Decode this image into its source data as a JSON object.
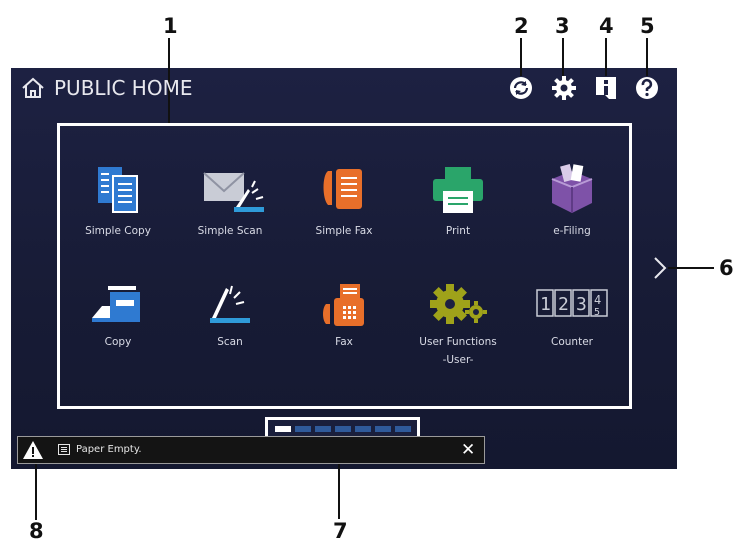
{
  "header": {
    "title": "PUBLIC HOME"
  },
  "callouts": [
    "1",
    "2",
    "3",
    "4",
    "5",
    "6",
    "7",
    "8"
  ],
  "apps": [
    {
      "label": "Simple Copy",
      "icon": "simple-copy-icon"
    },
    {
      "label": "Simple Scan",
      "icon": "simple-scan-icon"
    },
    {
      "label": "Simple Fax",
      "icon": "simple-fax-icon"
    },
    {
      "label": "Print",
      "icon": "printer-icon"
    },
    {
      "label": "e-Filing",
      "icon": "efiling-box-icon"
    },
    {
      "label": "Copy",
      "icon": "copy-icon"
    },
    {
      "label": "Scan",
      "icon": "scan-icon"
    },
    {
      "label": "Fax",
      "icon": "fax-icon"
    },
    {
      "label": "User Functions",
      "label2": "-User-",
      "icon": "gears-icon"
    },
    {
      "label": "Counter",
      "icon": "counter-icon"
    }
  ],
  "status": {
    "message": "Paper Empty.",
    "close": "✕"
  },
  "pager": {
    "pages": 7,
    "active": 1
  },
  "colors": {
    "screen_bg": "#1d2142",
    "accent_blue": "#2f7ad1",
    "fax_orange": "#e86f2a",
    "print_green": "#2aa56a",
    "efiling_purple": "#7e52a8",
    "gear_olive": "#9fa21a"
  }
}
